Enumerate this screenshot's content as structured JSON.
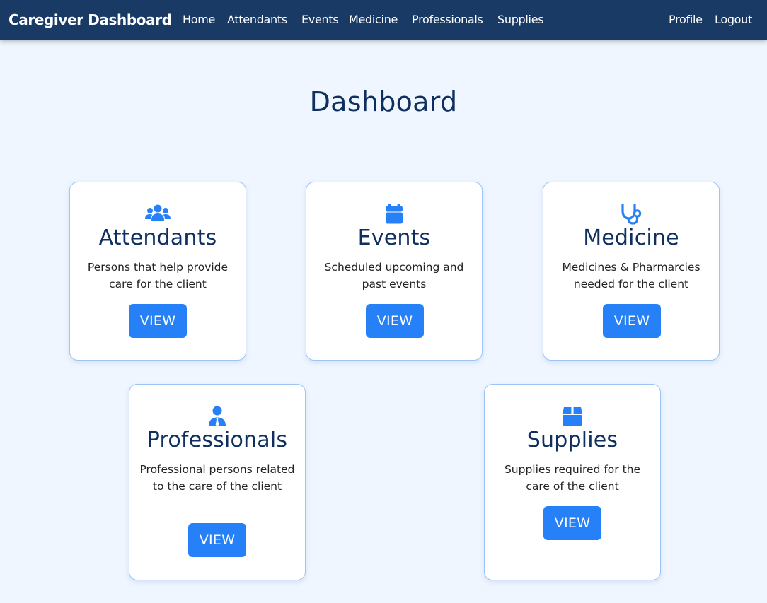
{
  "navbar": {
    "brand": "Caregiver Dashboard",
    "links": [
      "Home",
      "Attendants",
      "Events",
      "Medicine",
      "Professionals",
      "Supplies"
    ],
    "profile": "Profile",
    "logout": "Logout"
  },
  "page": {
    "title": "Dashboard"
  },
  "cards": [
    {
      "title": "Attendants",
      "description": "Persons that help provide care for the client",
      "button": "VIEW",
      "icon": "users-icon"
    },
    {
      "title": "Events",
      "description": "Scheduled upcoming and past events",
      "button": "VIEW",
      "icon": "calendar-icon"
    },
    {
      "title": "Medicine",
      "description": "Medicines & Pharmarcies needed for the client",
      "button": "VIEW",
      "icon": "stethoscope-icon"
    },
    {
      "title": "Professionals",
      "description": "Professional persons related to the care of the client",
      "button": "VIEW",
      "icon": "user-tie-icon"
    },
    {
      "title": "Supplies",
      "description": "Supplies required for the care of the client",
      "button": "VIEW",
      "icon": "box-icon"
    }
  ],
  "colors": {
    "navbar_bg": "#1a3a66",
    "page_bg": "#f0f6ff",
    "accent": "#2680f8",
    "heading": "#0f2f5e",
    "card_border": "#9cc4f5"
  }
}
